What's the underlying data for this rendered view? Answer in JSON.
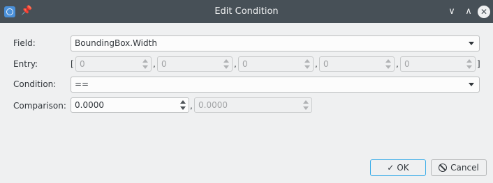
{
  "window": {
    "title": "Edit Condition",
    "pin_glyph": "📌",
    "min_glyph": "∨",
    "max_glyph": "∧",
    "close_glyph": "✕"
  },
  "form": {
    "field_label": "Field:",
    "field_value": "BoundingBox.Width",
    "entry_label": "Entry:",
    "entry_open": "[",
    "entry_close": "]",
    "entry_sep": ",",
    "entries": [
      "0",
      "0",
      "0",
      "0",
      "0"
    ],
    "condition_label": "Condition:",
    "condition_value": "==",
    "comparison_label": "Comparison:",
    "comparison_value": "0.0000",
    "comparison_sep": ",",
    "comparison_value2": "0.0000"
  },
  "buttons": {
    "ok_icon": "✓",
    "ok_label": "OK",
    "cancel_label": "Cancel"
  },
  "icons": {
    "app": "app-icon",
    "pin": "pin-icon",
    "minimize": "chevron-down-icon",
    "maximize": "chevron-up-icon",
    "close": "close-icon"
  },
  "colors": {
    "titlebar": "#475057",
    "window_bg": "#eff0f1",
    "focus_accent": "#3daee9"
  }
}
